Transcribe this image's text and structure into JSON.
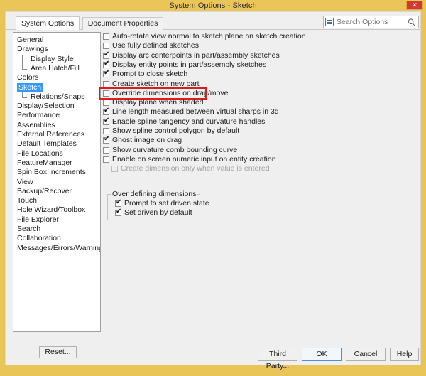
{
  "window": {
    "title": "System Options - Sketch",
    "close_label": "✕"
  },
  "tabs": [
    {
      "label": "System Options",
      "active": true
    },
    {
      "label": "Document Properties",
      "active": false
    }
  ],
  "search": {
    "placeholder": "Search Options",
    "left_icon": "options-list-icon",
    "right_icon": "magnifier-icon"
  },
  "sidebar": {
    "items": [
      {
        "label": "General",
        "child": false,
        "selected": false
      },
      {
        "label": "Drawings",
        "child": false,
        "selected": false
      },
      {
        "label": "Display Style",
        "child": true,
        "selected": false
      },
      {
        "label": "Area Hatch/Fill",
        "child": true,
        "selected": false,
        "last": true
      },
      {
        "label": "Colors",
        "child": false,
        "selected": false
      },
      {
        "label": "Sketch",
        "child": false,
        "selected": true
      },
      {
        "label": "Relations/Snaps",
        "child": true,
        "selected": false,
        "last": true
      },
      {
        "label": "Display/Selection",
        "child": false,
        "selected": false
      },
      {
        "label": "Performance",
        "child": false,
        "selected": false
      },
      {
        "label": "Assemblies",
        "child": false,
        "selected": false
      },
      {
        "label": "External References",
        "child": false,
        "selected": false
      },
      {
        "label": "Default Templates",
        "child": false,
        "selected": false
      },
      {
        "label": "File Locations",
        "child": false,
        "selected": false
      },
      {
        "label": "FeatureManager",
        "child": false,
        "selected": false
      },
      {
        "label": "Spin Box Increments",
        "child": false,
        "selected": false
      },
      {
        "label": "View",
        "child": false,
        "selected": false
      },
      {
        "label": "Backup/Recover",
        "child": false,
        "selected": false
      },
      {
        "label": "Touch",
        "child": false,
        "selected": false
      },
      {
        "label": "Hole Wizard/Toolbox",
        "child": false,
        "selected": false
      },
      {
        "label": "File Explorer",
        "child": false,
        "selected": false
      },
      {
        "label": "Search",
        "child": false,
        "selected": false
      },
      {
        "label": "Collaboration",
        "child": false,
        "selected": false
      },
      {
        "label": "Messages/Errors/Warnings",
        "child": false,
        "selected": false
      }
    ],
    "reset_label": "Reset..."
  },
  "options": {
    "checkboxes": [
      {
        "label": "Auto-rotate view normal to sketch plane on sketch creation",
        "checked": false,
        "enabled": true,
        "indented": false,
        "highlighted": false
      },
      {
        "label": "Use fully defined sketches",
        "checked": false,
        "enabled": true,
        "indented": false,
        "highlighted": false
      },
      {
        "label": "Display arc centerpoints in part/assembly sketches",
        "checked": true,
        "enabled": true,
        "indented": false,
        "highlighted": false
      },
      {
        "label": "Display entity points in part/assembly sketches",
        "checked": true,
        "enabled": true,
        "indented": false,
        "highlighted": false
      },
      {
        "label": "Prompt to close sketch",
        "checked": true,
        "enabled": true,
        "indented": false,
        "highlighted": false
      },
      {
        "label": "Create sketch on new part",
        "checked": false,
        "enabled": true,
        "indented": false,
        "highlighted": false
      },
      {
        "label": "Override dimensions on drag/move",
        "checked": false,
        "enabled": true,
        "indented": false,
        "highlighted": true
      },
      {
        "label": "Display plane when shaded",
        "checked": false,
        "enabled": true,
        "indented": false,
        "highlighted": false
      },
      {
        "label": "Line length measured between virtual sharps in 3d",
        "checked": true,
        "enabled": true,
        "indented": false,
        "highlighted": false
      },
      {
        "label": "Enable spline tangency and curvature handles",
        "checked": true,
        "enabled": true,
        "indented": false,
        "highlighted": false
      },
      {
        "label": "Show spline control polygon by default",
        "checked": false,
        "enabled": true,
        "indented": false,
        "highlighted": false
      },
      {
        "label": "Ghost image on drag",
        "checked": true,
        "enabled": true,
        "indented": false,
        "highlighted": false
      },
      {
        "label": "Show curvature comb bounding curve",
        "checked": false,
        "enabled": true,
        "indented": false,
        "highlighted": false
      },
      {
        "label": "Enable on screen numeric input on entity creation",
        "checked": false,
        "enabled": true,
        "indented": false,
        "highlighted": false
      },
      {
        "label": "Create dimension only when value is entered",
        "checked": false,
        "enabled": false,
        "indented": true,
        "highlighted": false
      }
    ],
    "group": {
      "title": "Over defining dimensions",
      "rows": [
        {
          "label": "Prompt to set driven state",
          "checked": true
        },
        {
          "label": "Set driven by default",
          "checked": true
        }
      ]
    },
    "check_glyph": "✔"
  },
  "buttons": {
    "third_party": "Third Party...",
    "ok": "OK",
    "cancel": "Cancel",
    "help": "Help"
  }
}
